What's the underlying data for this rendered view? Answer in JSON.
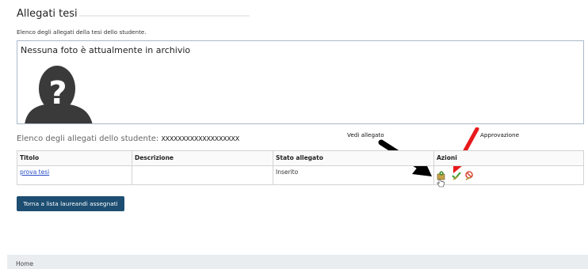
{
  "page": {
    "title": "Allegati tesi",
    "subtitle": "Elenco degli allegati della tesi dello studente."
  },
  "photo": {
    "message": "Nessuna foto è attualmente in archivio",
    "icon": "user-silhouette-question-mark"
  },
  "student": {
    "label": "Elenco degli allegati dello studente:",
    "name": "XXXXXXXXXXXXXXXXXXX"
  },
  "annotations": {
    "view_label": "Vedi allegato",
    "approval_label": "Approvazione",
    "black_arrow_color": "#000000",
    "red_arrow_color": "#e8191c"
  },
  "table": {
    "headers": [
      "Titolo",
      "Descrizione",
      "Stato allegato",
      "Azioni"
    ],
    "rows": [
      {
        "titolo": "prova tesi",
        "descrizione": "",
        "stato": "Inserito",
        "actions": [
          "view-attachment-icon",
          "approve-icon",
          "reject-icon"
        ]
      }
    ]
  },
  "buttons": {
    "back": "Torna a lista laureandi assegnati"
  },
  "footer": {
    "home": "Home"
  },
  "colors": {
    "button_bg": "#1d4e72",
    "link": "#2a4cc9",
    "box_border": "#a9b9c9",
    "footer_bg": "#eaedf0"
  }
}
